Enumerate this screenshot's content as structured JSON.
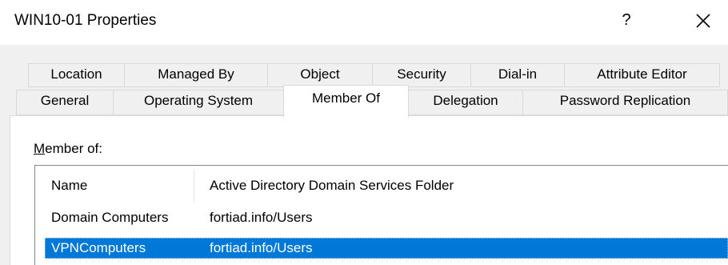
{
  "window": {
    "title": "WIN10-01 Properties",
    "help_label": "?",
    "close_icon": "close-icon"
  },
  "tabs": {
    "row1": [
      "Location",
      "Managed By",
      "Object",
      "Security",
      "Dial-in",
      "Attribute Editor"
    ],
    "row2": [
      "General",
      "Operating System",
      "Member Of",
      "Delegation",
      "Password Replication"
    ],
    "selected": "Member Of"
  },
  "member_of": {
    "label_mnemonic": "M",
    "label_rest": "ember of:",
    "columns": [
      "Name",
      "Active Directory Domain Services Folder"
    ],
    "rows": [
      {
        "name": "Domain Computers",
        "folder": "fortiad.info/Users",
        "selected": false
      },
      {
        "name": "VPNComputers",
        "folder": "fortiad.info/Users",
        "selected": true
      }
    ]
  },
  "colors": {
    "selection": "#0078d7",
    "dialog_bg": "#f0f0f0",
    "tab_border": "#d9d9d9"
  }
}
